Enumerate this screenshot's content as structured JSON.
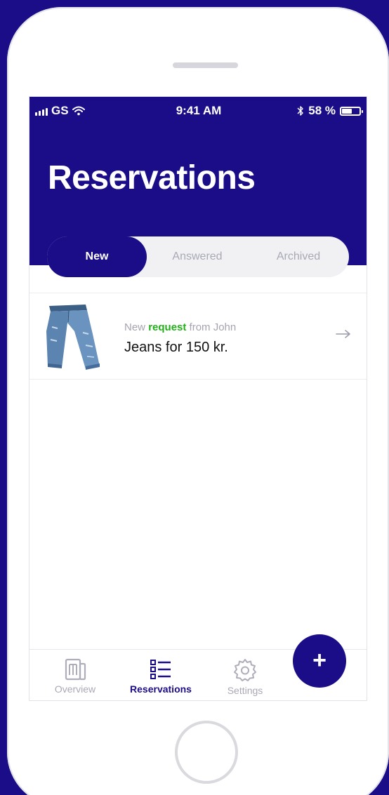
{
  "status_bar": {
    "carrier": "GS",
    "time": "9:41 AM",
    "battery_percent": "58 %",
    "battery_level": 0.58,
    "icons": [
      "signal-icon",
      "wifi-icon",
      "bluetooth-icon",
      "battery-icon"
    ]
  },
  "header": {
    "title": "Reservations"
  },
  "tabs": [
    {
      "label": "New",
      "active": true
    },
    {
      "label": "Answered",
      "active": false
    },
    {
      "label": "Archived",
      "active": false
    }
  ],
  "reservations": [
    {
      "prefix": "New ",
      "highlight": "request",
      "suffix": " from John",
      "title": "Jeans for 150 kr.",
      "thumbnail": "jeans-image",
      "action_icon": "arrow-right-icon"
    }
  ],
  "tabbar": {
    "items": [
      {
        "label": "Overview",
        "icon": "overview-icon",
        "active": false
      },
      {
        "label": "Reservations",
        "icon": "list-icon",
        "active": true
      },
      {
        "label": "Settings",
        "icon": "gear-icon",
        "active": false
      }
    ]
  },
  "fab": {
    "label": "+",
    "icon": "plus-icon"
  },
  "colors": {
    "primary": "#1a0d87",
    "highlight_green": "#22b019",
    "muted_text": "#a9a9b6",
    "background": "#ffffff"
  }
}
